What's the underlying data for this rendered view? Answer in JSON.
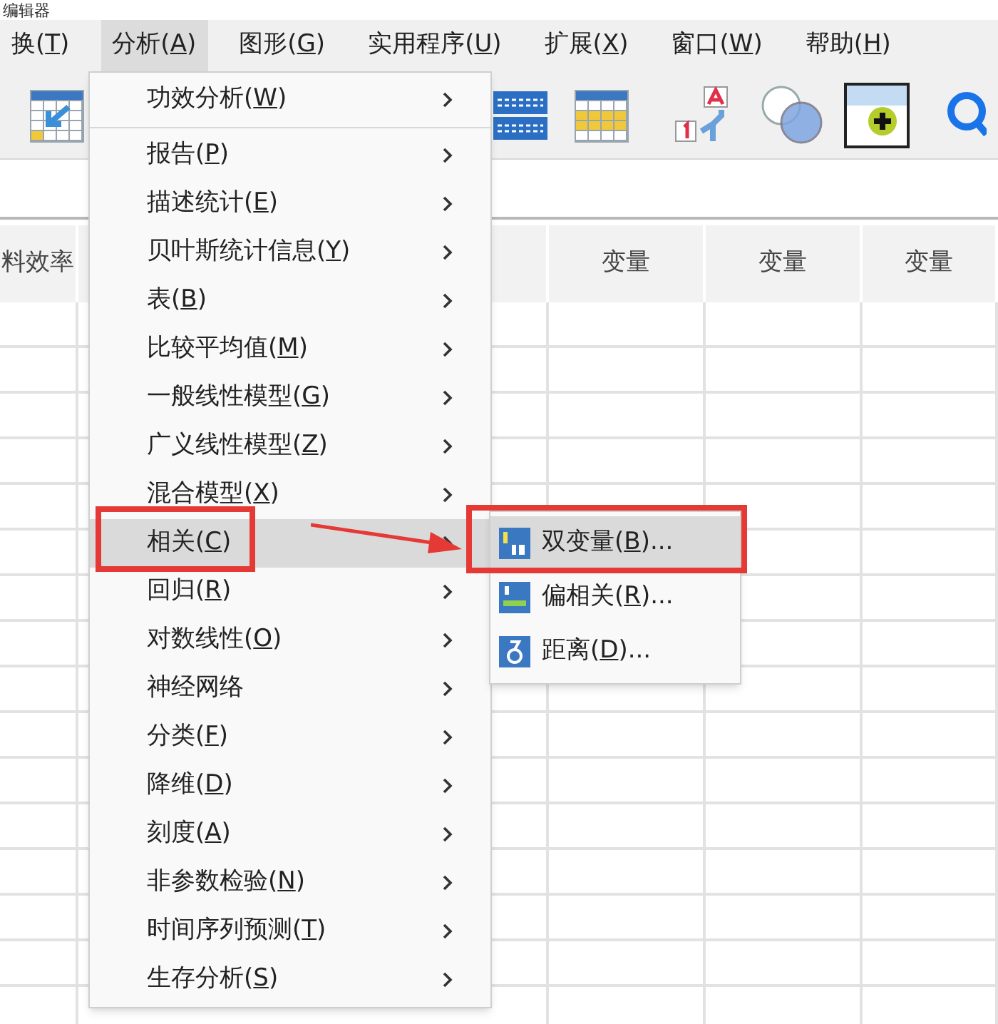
{
  "window": {
    "title": "编辑器"
  },
  "menu_bar": [
    {
      "label": "换(T)",
      "selected": false
    },
    {
      "label": "分析(A)",
      "selected": true
    },
    {
      "label": "图形(G)",
      "selected": false
    },
    {
      "label": "实用程序(U)",
      "selected": false
    },
    {
      "label": "扩展(X)",
      "selected": false
    },
    {
      "label": "窗口(W)",
      "selected": false
    },
    {
      "label": "帮助(H)",
      "selected": false
    }
  ],
  "grid": {
    "columns": [
      "料效率",
      "",
      "变量",
      "变量",
      "变量"
    ]
  },
  "analysis_menu": {
    "groups": [
      [
        {
          "label": "功效分析(W)",
          "selected": false
        }
      ],
      [
        {
          "label": "报告(P)",
          "selected": false
        },
        {
          "label": "描述统计(E)",
          "selected": false
        },
        {
          "label": "贝叶斯统计信息(Y)",
          "selected": false
        },
        {
          "label": "表(B)",
          "selected": false
        },
        {
          "label": "比较平均值(M)",
          "selected": false
        },
        {
          "label": "一般线性模型(G)",
          "selected": false
        },
        {
          "label": "广义线性模型(Z)",
          "selected": false
        },
        {
          "label": "混合模型(X)",
          "selected": false
        },
        {
          "label": "相关(C)",
          "selected": true
        },
        {
          "label": "回归(R)",
          "selected": false
        },
        {
          "label": "对数线性(O)",
          "selected": false
        },
        {
          "label": "神经网络",
          "selected": false
        },
        {
          "label": "分类(F)",
          "selected": false
        },
        {
          "label": "降维(D)",
          "selected": false
        },
        {
          "label": "刻度(A)",
          "selected": false
        },
        {
          "label": "非参数检验(N)",
          "selected": false
        },
        {
          "label": "时间序列预测(T)",
          "selected": false
        },
        {
          "label": "生存分析(S)",
          "selected": false
        }
      ]
    ]
  },
  "correlate_submenu": [
    {
      "label": "双变量(B)...",
      "selected": true,
      "kind": "bivariate"
    },
    {
      "label": "偏相关(R)...",
      "selected": false,
      "kind": "partial"
    },
    {
      "label": "距离(D)...",
      "selected": false,
      "kind": "distance"
    }
  ]
}
